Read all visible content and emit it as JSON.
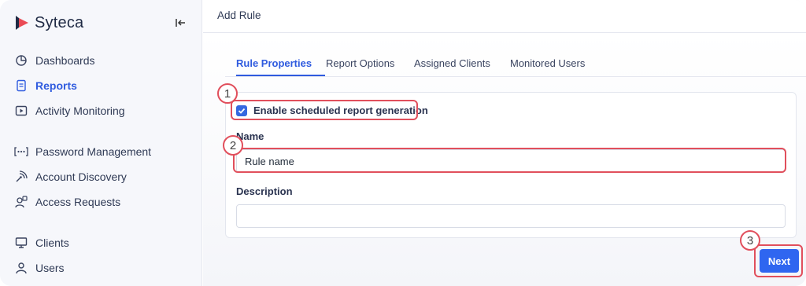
{
  "brand": {
    "name": "Syteca"
  },
  "sidebar": {
    "items": [
      {
        "label": "Dashboards",
        "icon": "dashboard-icon",
        "active": false
      },
      {
        "label": "Reports",
        "icon": "report-icon",
        "active": true
      },
      {
        "label": "Activity Monitoring",
        "icon": "play-icon",
        "active": false
      },
      {
        "label": "Password Management",
        "icon": "password-icon",
        "active": false
      },
      {
        "label": "Account Discovery",
        "icon": "discovery-icon",
        "active": false
      },
      {
        "label": "Access Requests",
        "icon": "access-request-icon",
        "active": false
      },
      {
        "label": "Clients",
        "icon": "monitor-icon",
        "active": false
      },
      {
        "label": "Users",
        "icon": "user-icon",
        "active": false
      }
    ]
  },
  "header": {
    "title": "Add Rule"
  },
  "tabs": [
    {
      "label": "Rule Properties",
      "active": true
    },
    {
      "label": "Report Options",
      "active": false
    },
    {
      "label": "Assigned Clients",
      "active": false
    },
    {
      "label": "Monitored Users",
      "active": false
    }
  ],
  "form": {
    "checkbox_label": "Enable scheduled report generation",
    "checkbox_checked": true,
    "name_label": "Name",
    "name_value": "Rule name",
    "description_label": "Description",
    "description_value": ""
  },
  "actions": {
    "next_label": "Next"
  },
  "annotations": [
    "1",
    "2",
    "3"
  ],
  "colors": {
    "accent": "#2f5bdf",
    "button": "#2f66f0",
    "highlight": "#e14f5c"
  }
}
